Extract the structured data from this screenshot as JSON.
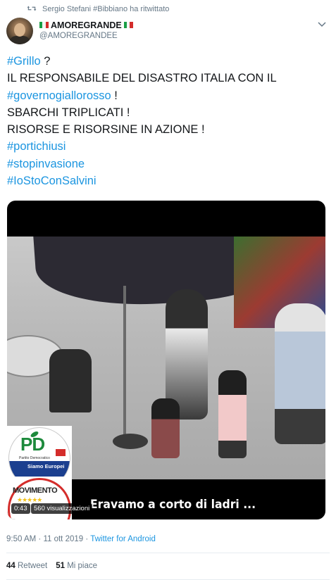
{
  "retweet": {
    "text": "Sergio Stefani #Bibbiano ha ritwittato",
    "icon": "retweet-icon"
  },
  "author": {
    "display_name": "AMOREGRANDE",
    "handle": "@AMOREGRANDEE",
    "flag_icon": "italian-flag-icon"
  },
  "tweet": {
    "lines": [
      [
        {
          "text": "#Grillo",
          "hashtag": true
        },
        {
          "text": " ?",
          "hashtag": false
        }
      ],
      [
        {
          "text": "IL RESPONSABILE DEL DISASTRO ITALIA CON IL",
          "hashtag": false
        }
      ],
      [
        {
          "text": "#governogiallorosso",
          "hashtag": true
        },
        {
          "text": " !",
          "hashtag": false
        }
      ],
      [
        {
          "text": "SBARCHI TRIPLICATI !",
          "hashtag": false
        }
      ],
      [
        {
          "text": "RISORSE E RISORSINE IN AZIONE !",
          "hashtag": false
        }
      ],
      [
        {
          "text": "#portichiusi",
          "hashtag": true
        }
      ],
      [
        {
          "text": "#stopinvasione",
          "hashtag": true
        }
      ],
      [
        {
          "text": "#IoStoConSalvini",
          "hashtag": true
        }
      ]
    ]
  },
  "media": {
    "caption": "Eravamo a corto di ladri ...",
    "duration": "0:43",
    "views": "560 visualizzazioni",
    "logo_pd": {
      "text": "PD",
      "subtitle": "Partito Democratico",
      "banner": "Siamo Europei",
      "badge": "PSE"
    },
    "logo_m5s": {
      "text": "MOVIMENTO"
    }
  },
  "meta": {
    "time": "9:50 AM",
    "date": "11 ott 2019",
    "separator": "·",
    "source": "Twitter for Android"
  },
  "stats": {
    "retweets_count": "44",
    "retweets_label": "Retweet",
    "likes_count": "51",
    "likes_label": "Mi piace"
  },
  "colors": {
    "link": "#1b95e0",
    "secondary_text": "#657786",
    "primary_text": "#14171a"
  }
}
